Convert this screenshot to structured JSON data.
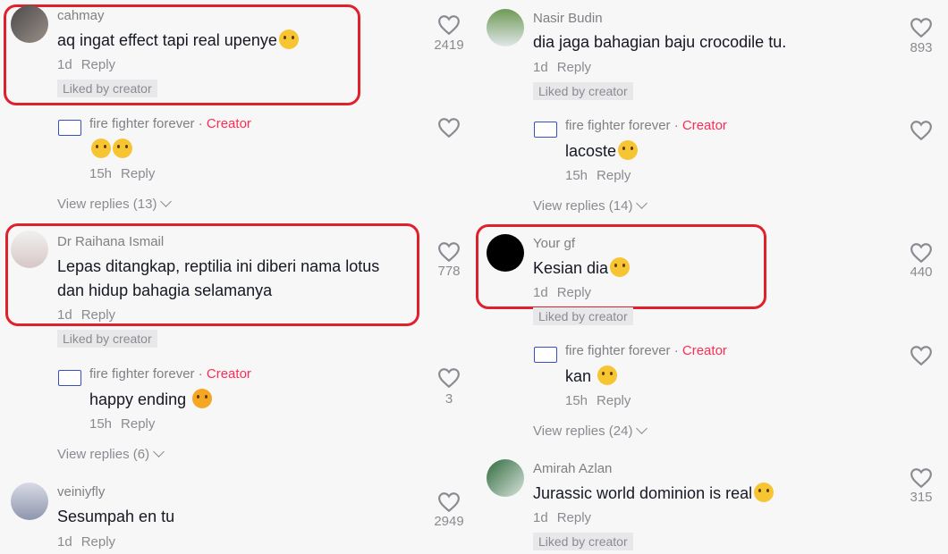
{
  "left": {
    "c1": {
      "user": "cahmay",
      "text": "aq ingat effect tapi real upenye",
      "time": "1d",
      "reply": "Reply",
      "liked": "Liked by creator",
      "likes": "2419"
    },
    "r1": {
      "user": "fire fighter forever",
      "sep": " · ",
      "creator": "Creator",
      "text": "",
      "time": "15h",
      "reply": "Reply"
    },
    "view1": "View replies (13)",
    "c2": {
      "user": "Dr Raihana Ismail",
      "text1": "Lepas ditangkap, reptilia ini diberi nama lotus",
      "text2": "dan hidup bahagia selamanya",
      "time": "1d",
      "reply": "Reply",
      "liked": "Liked by creator",
      "likes": "778"
    },
    "r2": {
      "user": "fire fighter forever",
      "sep": " · ",
      "creator": "Creator",
      "text": "happy ending",
      "time": "15h",
      "reply": "Reply",
      "likes": "3"
    },
    "view2": "View replies (6)",
    "c3": {
      "user": "veiniyfly",
      "text": "Sesumpah en tu",
      "time": "1d",
      "reply": "Reply",
      "likes": "2949"
    }
  },
  "right": {
    "c1": {
      "user": "Nasir Budin",
      "text": "dia jaga bahagian baju crocodile tu.",
      "time": "1d",
      "reply": "Reply",
      "liked": "Liked by creator",
      "likes": "893"
    },
    "r1": {
      "user": "fire fighter forever",
      "sep": " · ",
      "creator": "Creator",
      "text": "lacoste",
      "time": "15h",
      "reply": "Reply"
    },
    "view1": "View replies (14)",
    "c2": {
      "user": "Your gf",
      "text": "Kesian dia",
      "time": "1d",
      "reply": "Reply",
      "liked": "Liked by creator",
      "likes": "440"
    },
    "r2": {
      "user": "fire fighter forever",
      "sep": " · ",
      "creator": "Creator",
      "text": "kan",
      "time": "15h",
      "reply": "Reply"
    },
    "view2": "View replies (24)",
    "c3": {
      "user": "Amirah Azlan",
      "text": "Jurassic world dominion is real",
      "time": "1d",
      "reply": "Reply",
      "liked": "Liked by creator",
      "likes": "315"
    }
  },
  "colors": {
    "highlight": "#e0202a",
    "creator": "#fe2c55"
  },
  "icons": [
    "heart-icon",
    "chevron-down-icon",
    "avatar"
  ]
}
